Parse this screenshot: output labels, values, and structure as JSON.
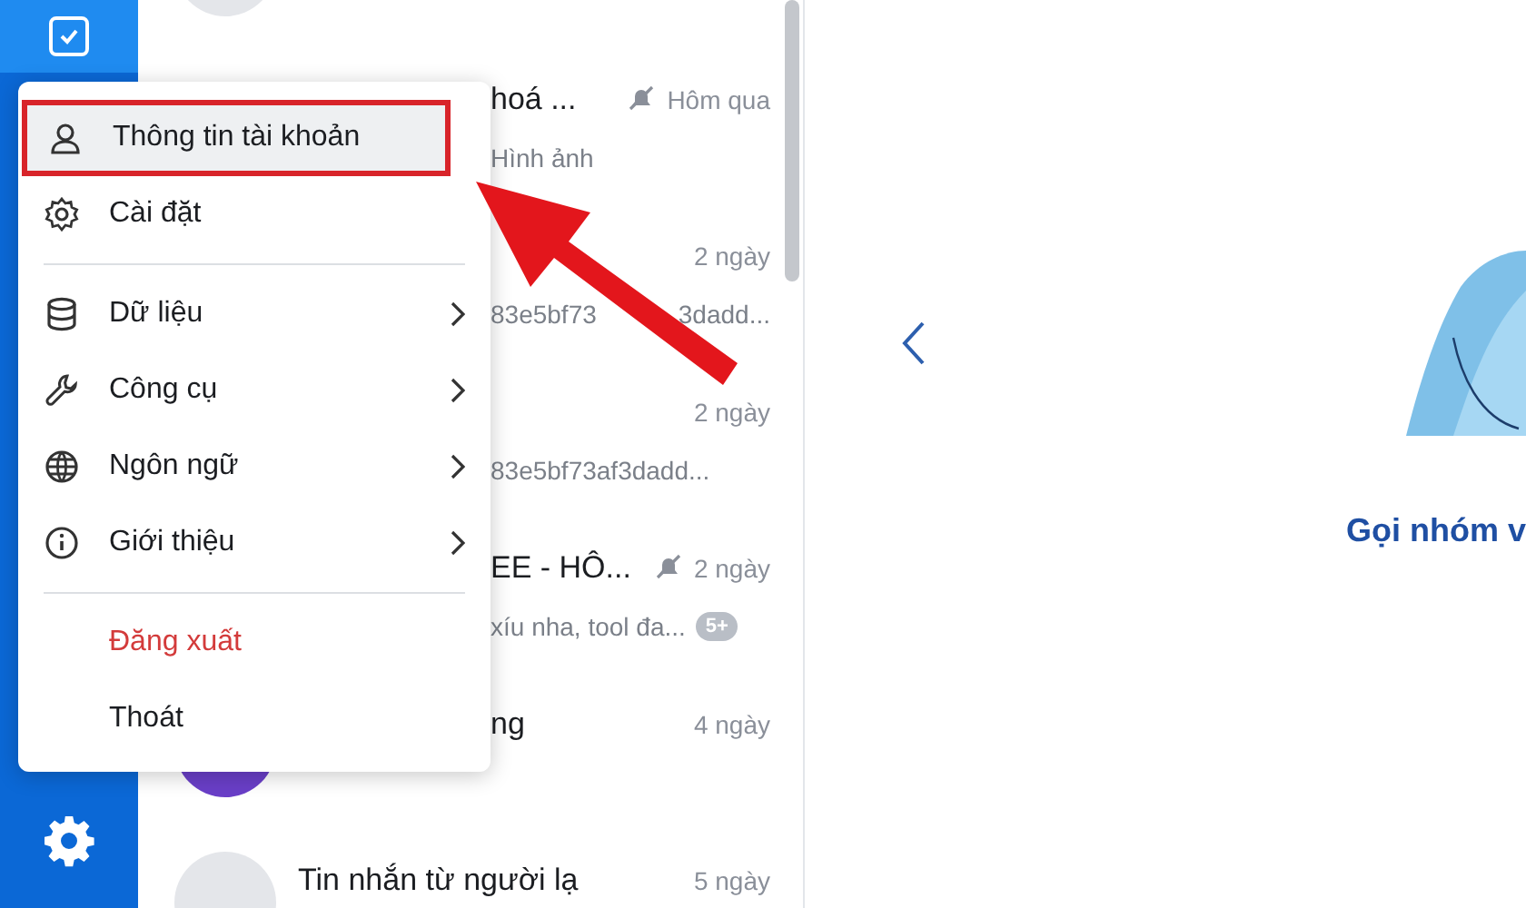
{
  "chats": [
    {
      "color": "#e4e6ea"
    },
    {
      "title": "hoá ...",
      "time": "Hôm qua",
      "subtitle": "Hình ảnh",
      "behind_menu": true,
      "muted": true
    },
    {
      "time": "2 ngày",
      "subtitle": "83e5bf73",
      "subtitle_tail": "3dadd...",
      "behind_menu": true,
      "muted": false
    },
    {
      "time": "2 ngày",
      "subtitle": "83e5bf73af3dadd...",
      "behind_menu": true,
      "muted": false
    },
    {
      "title": "EE - HÔ...",
      "time": "2 ngày",
      "subtitle": "xíu nha, tool đa...",
      "badge": "5+",
      "behind_menu": true,
      "muted": true
    },
    {
      "color": "#6a3fc8",
      "title": "ng",
      "time": "4 ngày",
      "behind_menu": true,
      "muted": false
    },
    {
      "color": "#e4e6ea",
      "title": "Tin nhắn từ người lạ",
      "time": "5 ngày",
      "behind_menu": false,
      "muted": false
    }
  ],
  "menu": {
    "sections": [
      {
        "items": [
          {
            "label": "Thông tin tài khoản",
            "selected": true,
            "submenu": false,
            "kind": "normal"
          },
          {
            "label": "Cài đặt",
            "selected": false,
            "submenu": false,
            "kind": "normal"
          }
        ]
      },
      {
        "items": [
          {
            "label": "Dữ liệu",
            "selected": false,
            "submenu": true,
            "kind": "normal"
          },
          {
            "label": "Công cụ",
            "selected": false,
            "submenu": true,
            "kind": "normal"
          },
          {
            "label": "Ngôn ngữ",
            "selected": false,
            "submenu": true,
            "kind": "normal"
          },
          {
            "label": "Giới thiệu",
            "selected": false,
            "submenu": true,
            "kind": "normal"
          }
        ]
      },
      {
        "items": [
          {
            "label": "Đăng xuất",
            "selected": false,
            "submenu": false,
            "kind": "danger"
          },
          {
            "label": "Thoát",
            "selected": false,
            "submenu": false,
            "kind": "plain"
          }
        ]
      }
    ]
  },
  "welcome": {
    "caption": "Gọi nhóm v"
  }
}
